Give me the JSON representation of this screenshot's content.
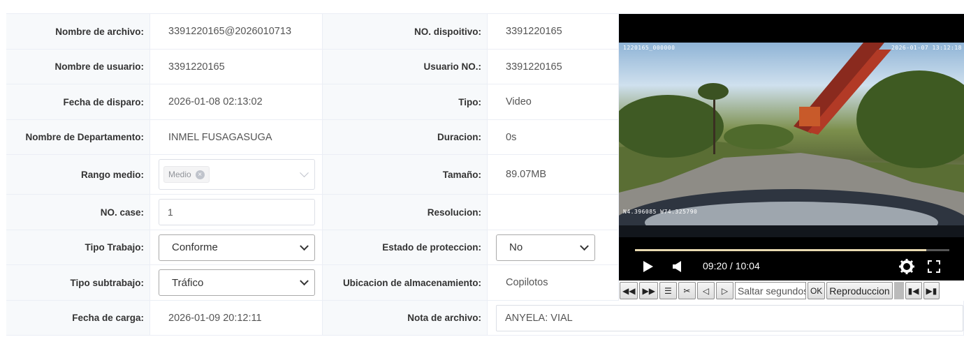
{
  "form": {
    "file_name_label": "Nombre de archivo:",
    "file_name_value": "3391220165@2026010713",
    "device_no_label": "NO. dispoitivo:",
    "device_no_value": "3391220165",
    "user_name_label": "Nombre de usuario:",
    "user_name_value": "3391220165",
    "user_no_label": "Usuario NO.:",
    "user_no_value": "3391220165",
    "trigger_date_label": "Fecha de disparo:",
    "trigger_date_value": "2026-01-08 02:13:02",
    "type_label": "Tipo:",
    "type_value": "Video",
    "department_label": "Nombre de Departamento:",
    "department_value": "INMEL FUSAGASUGA",
    "duration_label": "Duracion:",
    "duration_value": "0s",
    "range_label": "Rango medio:",
    "range_tag": "Medio",
    "size_label": "Tamaño:",
    "size_value": "89.07MB",
    "case_no_label": "NO. case:",
    "case_no_value": "1",
    "resolution_label": "Resolucion:",
    "resolution_value": "",
    "work_type_label": "Tipo Trabajo:",
    "work_type_value": "Conforme",
    "protection_label": "Estado de proteccion:",
    "protection_value": "No",
    "subwork_label": "Tipo subtrabajo:",
    "subwork_value": "Tráfico",
    "storage_label": "Ubicacion de almacenamiento:",
    "storage_value": "Copilotos",
    "upload_date_label": "Fecha de carga:",
    "upload_date_value": "2026-01-09 20:12:11",
    "note_label": "Nota de archivo:",
    "note_value": "ANYELA: VIAL"
  },
  "video": {
    "osd_id": "1220165_000000",
    "osd_time": "2026-01-07 13:12:18",
    "osd_gps": "N4.396085 W74.325790",
    "time_display": "09:20 / 10:04",
    "progress_fraction": 0.927
  },
  "toolbar": {
    "seek_placeholder": "Saltar segundos",
    "ok_label": "OK",
    "playback_label": "Reproduccion"
  }
}
